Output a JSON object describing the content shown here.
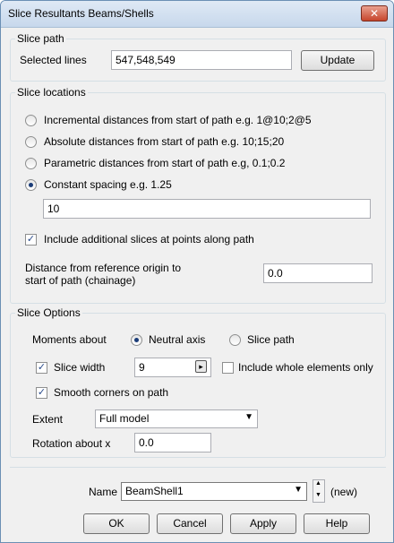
{
  "window": {
    "title": "Slice Resultants Beams/Shells",
    "close_glyph": "✕"
  },
  "slice_path": {
    "group_label": "Slice path",
    "selected_lines_label": "Selected lines",
    "selected_lines_value": "547,548,549",
    "update_label": "Update"
  },
  "slice_locations": {
    "group_label": "Slice locations",
    "options": [
      {
        "label": "Incremental distances from start of path e.g. 1@10;2@5",
        "checked": false
      },
      {
        "label": "Absolute distances from start of path e.g. 10;15;20",
        "checked": false
      },
      {
        "label": "Parametric distances from start of path e.g, 0.1;0.2",
        "checked": false
      },
      {
        "label": "Constant spacing e.g. 1.25",
        "checked": true
      }
    ],
    "spacing_value": "10",
    "include_additional_label": "Include additional slices at points along path",
    "include_additional_checked": true,
    "chainage_label_line1": "Distance from reference origin to",
    "chainage_label_line2": "start of path (chainage)",
    "chainage_value": "0.0"
  },
  "slice_options": {
    "group_label": "Slice Options",
    "moments_about_label": "Moments about",
    "neutral_axis_label": "Neutral axis",
    "slice_path_label": "Slice path",
    "slice_width_label": "Slice width",
    "slice_width_value": "9",
    "include_whole_label": "Include whole elements only",
    "smooth_corners_label": "Smooth corners on path",
    "extent_label": "Extent",
    "extent_value": "Full model",
    "rotation_label": "Rotation about x",
    "rotation_value": "0.0"
  },
  "name_row": {
    "name_label": "Name",
    "name_value": "BeamShell1",
    "new_label": "(new)"
  },
  "buttons": {
    "ok": "OK",
    "cancel": "Cancel",
    "apply": "Apply",
    "help": "Help"
  },
  "icons": {
    "dropdown": "chevron-down-icon",
    "spinner": "spinner-icon",
    "check": "check-icon",
    "close": "close-icon"
  }
}
